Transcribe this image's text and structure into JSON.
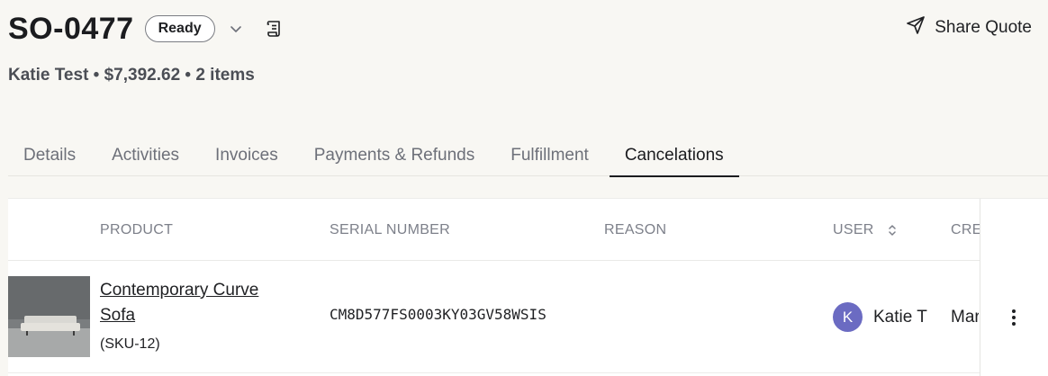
{
  "order": {
    "id": "SO-0477",
    "status": "Ready",
    "summary": "Katie Test • $7,392.62 • 2 items"
  },
  "actions": {
    "share_label": "Share Quote"
  },
  "tabs": [
    {
      "label": "Details"
    },
    {
      "label": "Activities"
    },
    {
      "label": "Invoices"
    },
    {
      "label": "Payments & Refunds"
    },
    {
      "label": "Fulfillment"
    },
    {
      "label": "Cancelations",
      "active": true
    }
  ],
  "table": {
    "columns": {
      "product": "PRODUCT",
      "serial": "SERIAL NUMBER",
      "reason": "REASON",
      "user": "USER",
      "created": "CRE"
    },
    "rows": [
      {
        "product_name": "Contemporary Curve Sofa",
        "sku": "(SKU-12)",
        "serial": "CM8D577FS0003KY03GV58WSIS",
        "reason": "",
        "user_initial": "K",
        "user_name": "Katie T",
        "created": "Mar"
      }
    ]
  },
  "icons": {
    "status_dropdown": "chevron-down-icon",
    "document": "receipt-icon",
    "share": "send-icon",
    "sort": "sort-icon",
    "row_menu": "more-vertical-icon"
  },
  "colors": {
    "background": "#f8f7f3",
    "avatar": "#6b6bc2",
    "text_primary": "#1f2023",
    "text_muted": "#7d808a"
  }
}
